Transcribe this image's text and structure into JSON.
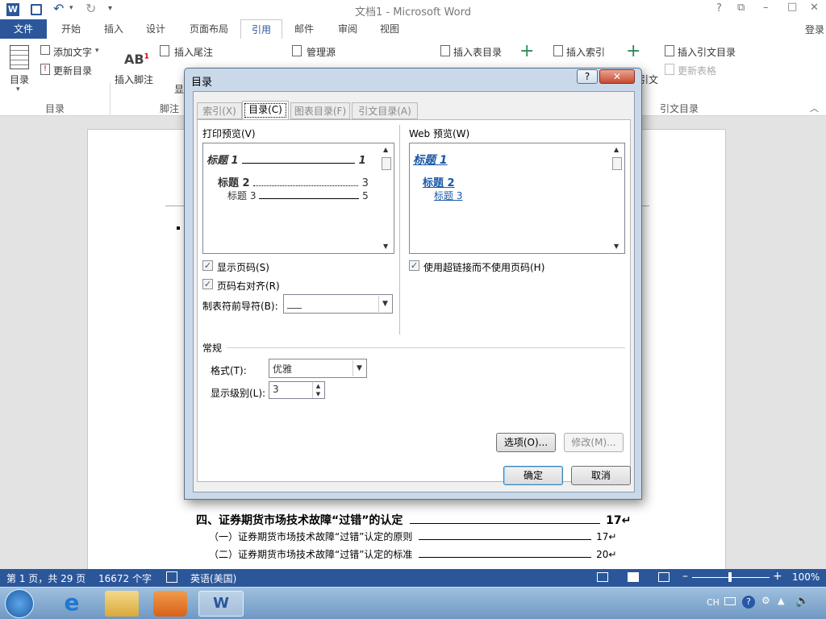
{
  "window": {
    "title": "文档1 - Microsoft Word",
    "help": "?",
    "restore": "⧉",
    "minimize": "–",
    "maximize": "□",
    "close": "✕",
    "login": "登录"
  },
  "ribbon_tabs": [
    {
      "label": "文件"
    },
    {
      "label": "开始"
    },
    {
      "label": "插入"
    },
    {
      "label": "设计"
    },
    {
      "label": "页面布局"
    },
    {
      "label": "引用"
    },
    {
      "label": "邮件"
    },
    {
      "label": "审阅"
    },
    {
      "label": "视图"
    }
  ],
  "ribbon": {
    "toc_button": "目录",
    "add_text": "添加文字",
    "update_toc": "更新目录",
    "insert_footnote": "插入脚注",
    "insert_endnote": "插入尾注",
    "show_notes_partial": "显",
    "manage_sources": "管理源",
    "insert_caption_partial": "插入表目录",
    "insert_index": "插入索引",
    "mark_citation_partial": "引文",
    "insert_toa": "插入引文目录",
    "update_table": "更新表格",
    "groups": {
      "toc": "目录",
      "footnotes": "脚注",
      "toa": "引文目录"
    }
  },
  "dialog": {
    "title": "目录",
    "help": "?",
    "close": "✕",
    "tabs": [
      {
        "label": "索引(X)"
      },
      {
        "label": "目录(C)"
      },
      {
        "label": "图表目录(F)"
      },
      {
        "label": "引文目录(A)"
      }
    ],
    "print_preview_label": "打印预览(V)",
    "web_preview_label": "Web 预览(W)",
    "print_preview": [
      {
        "text": "标题 1",
        "page": "1"
      },
      {
        "text": "标题 2",
        "page": "3"
      },
      {
        "text": "标题 3",
        "page": "5"
      }
    ],
    "web_preview": [
      {
        "text": "标题 1"
      },
      {
        "text": "标题 2"
      },
      {
        "text": "标题 3"
      }
    ],
    "show_page_numbers": {
      "label": "显示页码(S)",
      "checked": true
    },
    "right_align": {
      "label": "页码右对齐(R)",
      "checked": true
    },
    "use_hyperlinks": {
      "label": "使用超链接而不使用页码(H)",
      "checked": true
    },
    "tab_leader_label": "制表符前导符(B):",
    "tab_leader_value": "___",
    "general_label": "常规",
    "format_label": "格式(T):",
    "format_value": "优雅",
    "levels_label": "显示级别(L):",
    "levels_value": "3",
    "options_button": "选项(O)...",
    "modify_button": "修改(M)...",
    "ok_button": "确定",
    "cancel_button": "取消"
  },
  "document": {
    "lines": [
      {
        "text": "四、证券期货市场技术故障“过错”的认定",
        "page": "17↵"
      },
      {
        "text": "（一）证券期货市场技术故障“过错”认定的原则",
        "page": "17↵"
      },
      {
        "text": "（二）证券期货市场技术故障“过错”认定的标准",
        "page": "20↵"
      }
    ]
  },
  "status": {
    "page": "第 1 页，共 29 页",
    "words": "16672 个字",
    "language": "英语(美国)",
    "zoom": "100%"
  },
  "taskbar": {
    "ime": "CH"
  }
}
